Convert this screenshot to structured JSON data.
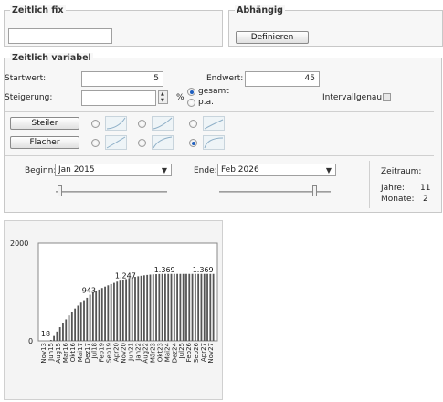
{
  "fixed_group": {
    "title": "Zeitlich fix",
    "value": ""
  },
  "dependent_group": {
    "title": "Abhängig",
    "define_label": "Definieren"
  },
  "variable_group": {
    "title": "Zeitlich variabel",
    "start_label": "Startwert:",
    "start_value": "5",
    "end_label": "Endwert:",
    "end_value": "45",
    "increase_label": "Steigerung:",
    "increase_value": "",
    "percent_label": "%",
    "radio_total_label": "gesamt",
    "radio_pa_label": "p.a.",
    "interval_label": "Intervallgenau:",
    "steeper_label": "Steiler",
    "flatter_label": "Flacher",
    "begin_label": "Beginn:",
    "begin_value": "Jan 2015",
    "end_date_label": "Ende:",
    "end_date_value": "Feb 2026",
    "period_label": "Zeitraum:",
    "years_label": "Jahre:",
    "years_value": "11",
    "months_label": "Monate:",
    "months_value": "2"
  },
  "icons": {
    "combo_arrow": "chevron-down-icon",
    "spin": "spinner-arrows-icon",
    "curve": "curve-preview-icon"
  },
  "colors": {
    "bar": "#555555",
    "panel_bg": "#f7f7f7",
    "radio_selected": "#1f5fbf"
  },
  "chart_data": {
    "type": "bar",
    "ylim": [
      0,
      2000
    ],
    "ytick_labels": [
      "0",
      "2000"
    ],
    "x_labels": [
      "Nov13",
      "Jun15",
      "Aug15",
      "Mar16",
      "Okt16",
      "Mai17",
      "Dez17",
      "Jul18",
      "Feb19",
      "Sep19",
      "Apr20",
      "Nov20",
      "Jun21",
      "Jan22",
      "Aug22",
      "Mär23",
      "Okt23",
      "Mai24",
      "Dez24",
      "Jul25",
      "Feb26",
      "Sep26",
      "Apr27",
      "Nov27"
    ],
    "data_labels": [
      {
        "text": "18",
        "value": 18
      },
      {
        "text": "943",
        "value": 943
      },
      {
        "text": "1.247",
        "value": 1247
      },
      {
        "text": "1.369",
        "value": 1369
      },
      {
        "text": "1.369",
        "value": 1369
      }
    ],
    "bar_count": 58,
    "bar_values": [
      0,
      0,
      0,
      18,
      100,
      190,
      280,
      360,
      440,
      520,
      590,
      660,
      720,
      780,
      830,
      880,
      943,
      980,
      1015,
      1048,
      1080,
      1108,
      1135,
      1160,
      1185,
      1210,
      1230,
      1247,
      1263,
      1280,
      1295,
      1308,
      1320,
      1330,
      1340,
      1348,
      1355,
      1360,
      1364,
      1367,
      1369,
      1369,
      1369,
      1369,
      1369,
      1369,
      1369,
      1369,
      1369,
      1369,
      1369,
      1369,
      1369,
      1369,
      1369,
      1369,
      1369,
      1369
    ]
  }
}
